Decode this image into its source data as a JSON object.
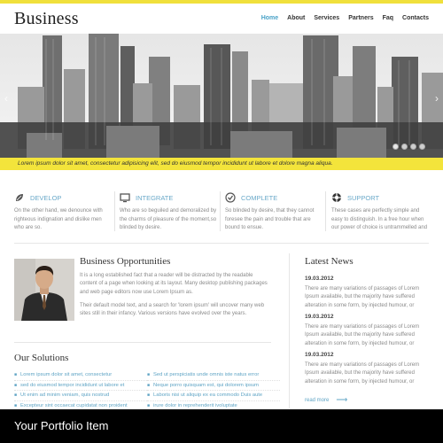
{
  "header": {
    "logo": "Business",
    "nav": [
      "Home",
      "About",
      "Services",
      "Partners",
      "Faq",
      "Contacts"
    ]
  },
  "hero": {
    "caption": "Lorem ipsum dolor sit amet, consectetur adipisicing elit, sed do eiusmod tempor incididunt ut labore et dolore magna aliqua.",
    "slides_count": 4,
    "active_slide": 1
  },
  "services": [
    {
      "title": "DEVELOP",
      "icon": "leaf-icon",
      "text": "On the other hand, we denounce with righteous indignation and dislike men who are so."
    },
    {
      "title": "INTEGRATE",
      "icon": "monitor-icon",
      "text": "Who are so beguiled and demoralized by the charms of pleasure of the moment,so blinded by desire."
    },
    {
      "title": "COMPLETE",
      "icon": "check-circle-icon",
      "text": "So blinded by desire, that they cannot foresee the pain and trouble that are bound to ensue."
    },
    {
      "title": "SUPPORT",
      "icon": "lifebuoy-icon",
      "text": "These cases are perfectly simple and easy to distinguish. In a free hour when our power of choice is untrammelled and"
    }
  ],
  "business": {
    "title": "Business Opportunities",
    "p1": "It is a long established fact that a reader will be distracted by the readable content of a page when looking at its layout. Many desktop publishing packages and web page editors now use Lorem Ipsum as.",
    "p2": "Their default model text, and a search for 'lorem ipsum' will uncover many web sites still in their infancy. Various versions have evolved over the years."
  },
  "solutions": {
    "title": "Our Solutions",
    "left": [
      "Lorem ipsum dolor sit amet, consectetur",
      "sed do eiusmod tempor incididunt ut labore et",
      "Ut enim ad minim veniam, quis nostrud",
      "Excepteur sint occaecat cupidatat non proident"
    ],
    "right": [
      "Sed ut perspiciatis unde omnis iste natus error",
      "Neque porro quisquam est, qui dolorem ipsum",
      "Laboris nisi ut aliquip ex ea commodo Duis aute",
      "irure dolor in reprehenderit ivoluptate"
    ]
  },
  "news": {
    "title": "Latest News",
    "items": [
      {
        "date": "19.03.2012",
        "text": "There are many variations of passages of Lorem Ipsum available, but the majority have suffered alteration in some form, by injected humour, or"
      },
      {
        "date": "19.03.2012",
        "text": "There are many variations of passages of Lorem Ipsum available, but the majority have suffered alteration in some form, by injected humour, or"
      },
      {
        "date": "19.03.2012",
        "text": "There are many variations of passages of Lorem Ipsum available, but the majority have suffered alteration in some form, by injected humour, or"
      }
    ],
    "read_more": "read more"
  },
  "footer": {
    "title": "Your Portfolio Item"
  },
  "colors": {
    "accent": "#f3e43b",
    "link": "#4aa3c8",
    "footer": "#000000"
  }
}
